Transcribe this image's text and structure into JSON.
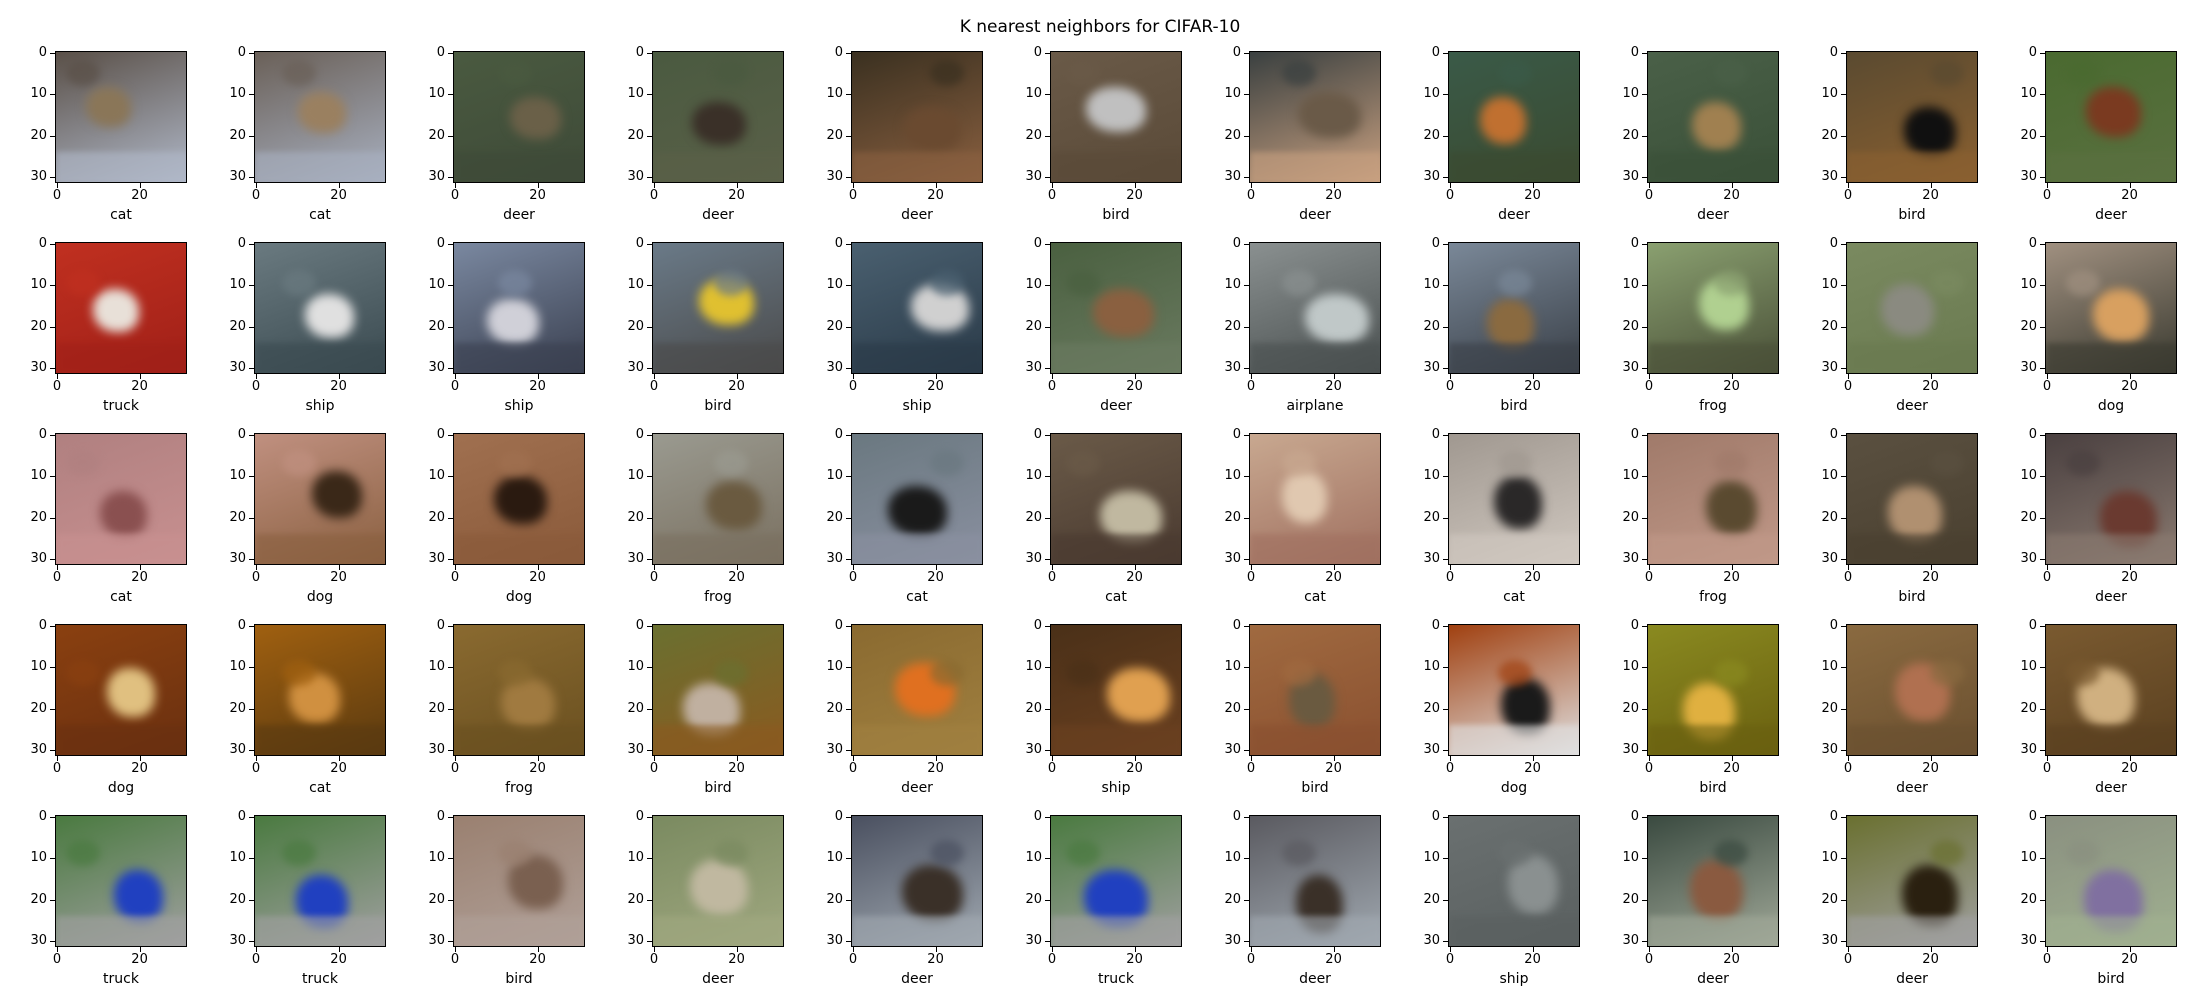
{
  "figure": {
    "title": "K nearest neighbors for CIFAR-10",
    "y_ticks": [
      "0",
      "10",
      "20",
      "30"
    ],
    "x_ticks": [
      "0",
      "20"
    ],
    "x_range": [
      0,
      31
    ],
    "y_range": [
      0,
      31
    ]
  },
  "grid": {
    "rows": 5,
    "cols": 11,
    "labels": [
      [
        "cat",
        "cat",
        "deer",
        "deer",
        "deer",
        "bird",
        "deer",
        "deer",
        "deer",
        "bird",
        "deer"
      ],
      [
        "truck",
        "ship",
        "ship",
        "bird",
        "ship",
        "deer",
        "airplane",
        "bird",
        "frog",
        "deer",
        "dog"
      ],
      [
        "cat",
        "dog",
        "dog",
        "frog",
        "cat",
        "cat",
        "cat",
        "cat",
        "frog",
        "bird",
        "deer"
      ],
      [
        "dog",
        "cat",
        "frog",
        "bird",
        "deer",
        "ship",
        "bird",
        "dog",
        "bird",
        "deer",
        "deer"
      ],
      [
        "truck",
        "truck",
        "bird",
        "deer",
        "deer",
        "truck",
        "deer",
        "ship",
        "deer",
        "deer",
        "bird"
      ]
    ],
    "image_colors": [
      [
        [
          "#5a5048",
          "#8a7658",
          "#b0b8c8"
        ],
        [
          "#6a6058",
          "#9a8060",
          "#a8b0c0"
        ],
        [
          "#4a5a40",
          "#6a6048",
          "#3e4a38"
        ],
        [
          "#4a5a40",
          "#3a3028",
          "#5a6048"
        ],
        [
          "#3a3020",
          "#6a4a30",
          "#8a6040"
        ],
        [
          "#6a5a48",
          "#c0c0c0",
          "#5a4a38"
        ],
        [
          "#3a4040",
          "#6a5a48",
          "#c8a080"
        ],
        [
          "#3a5a48",
          "#c07030",
          "#3a4a30"
        ],
        [
          "#4a6048",
          "#a08050",
          "#3a5038"
        ],
        [
          "#5a4a30",
          "#101010",
          "#8a6030"
        ],
        [
          "#4a6a30",
          "#7a3a20",
          "#5a7040"
        ]
      ],
      [
        [
          "#c03020",
          "#e8e0d8",
          "#a02018"
        ],
        [
          "#6a7a80",
          "#e0e0e0",
          "#3a4a50"
        ],
        [
          "#7a88a0",
          "#d0d0d8",
          "#3a4050"
        ],
        [
          "#6a7a88",
          "#e0c030",
          "#4a4a4a"
        ],
        [
          "#4a6070",
          "#d0d0d0",
          "#2a3a48"
        ],
        [
          "#4a6040",
          "#8a6040",
          "#6a7a60"
        ],
        [
          "#8a9090",
          "#c0c8c8",
          "#4a5050"
        ],
        [
          "#7a8898",
          "#8a6a40",
          "#3a4048"
        ],
        [
          "#8aa070",
          "#b0d090",
          "#4a5038"
        ],
        [
          "#7a8a60",
          "#8a8a80",
          "#6a7a50"
        ],
        [
          "#a09080",
          "#d8a060",
          "#3a3a30"
        ]
      ],
      [
        [
          "#b08080",
          "#8a5050",
          "#c89090"
        ],
        [
          "#c09080",
          "#3a2818",
          "#8a6040"
        ],
        [
          "#a07050",
          "#2a1a10",
          "#8a5a3a"
        ],
        [
          "#9a9a90",
          "#6a5a40",
          "#7a7060"
        ],
        [
          "#6a7880",
          "#1a1a1a",
          "#8a90a0"
        ],
        [
          "#6a5a48",
          "#c0b8a0",
          "#4a3a30"
        ],
        [
          "#c8a890",
          "#e0c8b0",
          "#a07060"
        ],
        [
          "#a09890",
          "#2a2828",
          "#d0c8c0"
        ],
        [
          "#a07a6a",
          "#5a4a30",
          "#c09888"
        ],
        [
          "#5a5040",
          "#b09070",
          "#4a4030"
        ],
        [
          "#4a4040",
          "#6a3a30",
          "#8a7a70"
        ]
      ],
      [
        [
          "#8a4010",
          "#e0c080",
          "#6a3010"
        ],
        [
          "#a06010",
          "#d09040",
          "#5a3a10"
        ],
        [
          "#8a6a30",
          "#a07a40",
          "#6a5020"
        ],
        [
          "#6a7030",
          "#c0b0a0",
          "#8a5a20"
        ],
        [
          "#8a6a30",
          "#e07020",
          "#a08040"
        ],
        [
          "#4a3018",
          "#e0a050",
          "#6a4020"
        ],
        [
          "#a06a40",
          "#6a5a40",
          "#8a5030"
        ],
        [
          "#a04010",
          "#1a1a1a",
          "#e0e0e0"
        ],
        [
          "#8a8a20",
          "#e0b040",
          "#6a6010"
        ],
        [
          "#8a6a40",
          "#b07050",
          "#6a5030"
        ],
        [
          "#7a5a30",
          "#d0b080",
          "#5a4020"
        ]
      ],
      [
        [
          "#4a7a40",
          "#2040c0",
          "#a0a0a0"
        ],
        [
          "#4a7a40",
          "#2040c0",
          "#a0a0a0"
        ],
        [
          "#9a8070",
          "#7a6050",
          "#b0a098"
        ],
        [
          "#7a8a60",
          "#c0b8a0",
          "#a0a880"
        ],
        [
          "#4a5060",
          "#3a3028",
          "#a0a8b0"
        ],
        [
          "#4a7a40",
          "#2040c0",
          "#a0a0a0"
        ],
        [
          "#5a5a60",
          "#3a3028",
          "#a0a8b0"
        ],
        [
          "#6a7070",
          "#8a9090",
          "#5a6060"
        ],
        [
          "#3a4a40",
          "#8a5a40",
          "#a0a898"
        ],
        [
          "#6a7030",
          "#2a2010",
          "#a0a0a0"
        ],
        [
          "#8a9080",
          "#8070a0",
          "#a0b090"
        ]
      ]
    ]
  }
}
